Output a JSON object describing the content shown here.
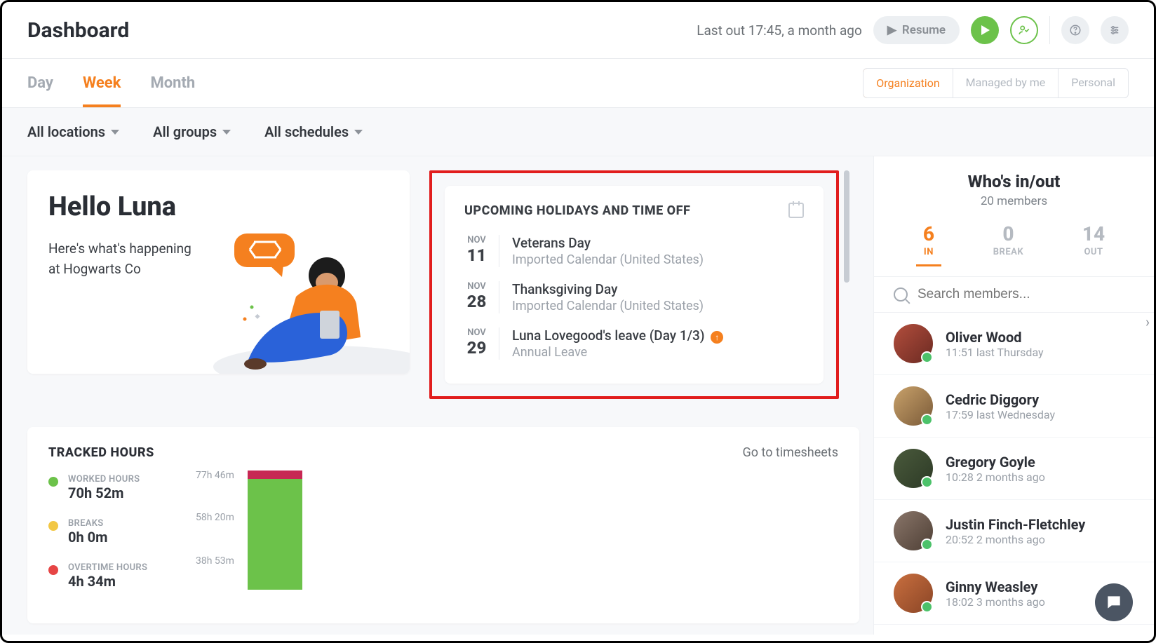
{
  "header": {
    "title": "Dashboard",
    "last_out": "Last out 17:45, a month ago",
    "resume_label": "Resume"
  },
  "tabs": {
    "day": "Day",
    "week": "Week",
    "month": "Month"
  },
  "scope": {
    "org": "Organization",
    "managed": "Managed by me",
    "personal": "Personal"
  },
  "filters": {
    "locations": "All locations",
    "groups": "All groups",
    "schedules": "All schedules"
  },
  "hello": {
    "greeting": "Hello Luna",
    "sub": "Here's what's happening at Hogwarts Co"
  },
  "upcoming": {
    "title": "UPCOMING HOLIDAYS AND TIME OFF",
    "items": [
      {
        "month": "NOV",
        "day": "11",
        "title": "Veterans Day",
        "sub": "Imported Calendar (United States)",
        "badge": false
      },
      {
        "month": "NOV",
        "day": "28",
        "title": "Thanksgiving Day",
        "sub": "Imported Calendar (United States)",
        "badge": false
      },
      {
        "month": "NOV",
        "day": "29",
        "title": "Luna Lovegood's leave (Day 1/3)",
        "sub": "Annual Leave",
        "badge": true
      }
    ]
  },
  "tracked": {
    "title": "TRACKED HOURS",
    "link": "Go to timesheets",
    "legend": [
      {
        "color": "#6cc24a",
        "label": "WORKED HOURS",
        "value": "70h 52m"
      },
      {
        "color": "#f2c744",
        "label": "BREAKS",
        "value": "0h 0m"
      },
      {
        "color": "#e64545",
        "label": "OVERTIME HOURS",
        "value": "4h 34m"
      }
    ]
  },
  "chart_data": {
    "type": "bar",
    "y_ticks": [
      "77h 46m",
      "58h 20m",
      "38h 53m"
    ],
    "series": [
      {
        "name": "Worked",
        "color": "#6cc24a",
        "values": [
          70.87
        ]
      },
      {
        "name": "Overtime",
        "color": "#c72854",
        "values": [
          4.57
        ]
      }
    ],
    "ylim_minutes": [
      0,
      4666
    ]
  },
  "whos": {
    "title": "Who's in/out",
    "sub": "20 members",
    "counts": {
      "in_n": "6",
      "in_l": "IN",
      "break_n": "0",
      "break_l": "BREAK",
      "out_n": "14",
      "out_l": "OUT"
    },
    "search_placeholder": "Search members...",
    "members": [
      {
        "name": "Oliver Wood",
        "time": "11:51 last Thursday"
      },
      {
        "name": "Cedric Diggory",
        "time": "17:59 last Wednesday"
      },
      {
        "name": "Gregory Goyle",
        "time": "10:28 2 months ago"
      },
      {
        "name": "Justin Finch-Fletchley",
        "time": "20:52 2 months ago"
      },
      {
        "name": "Ginny Weasley",
        "time": "18:02 3 months ago"
      }
    ]
  }
}
